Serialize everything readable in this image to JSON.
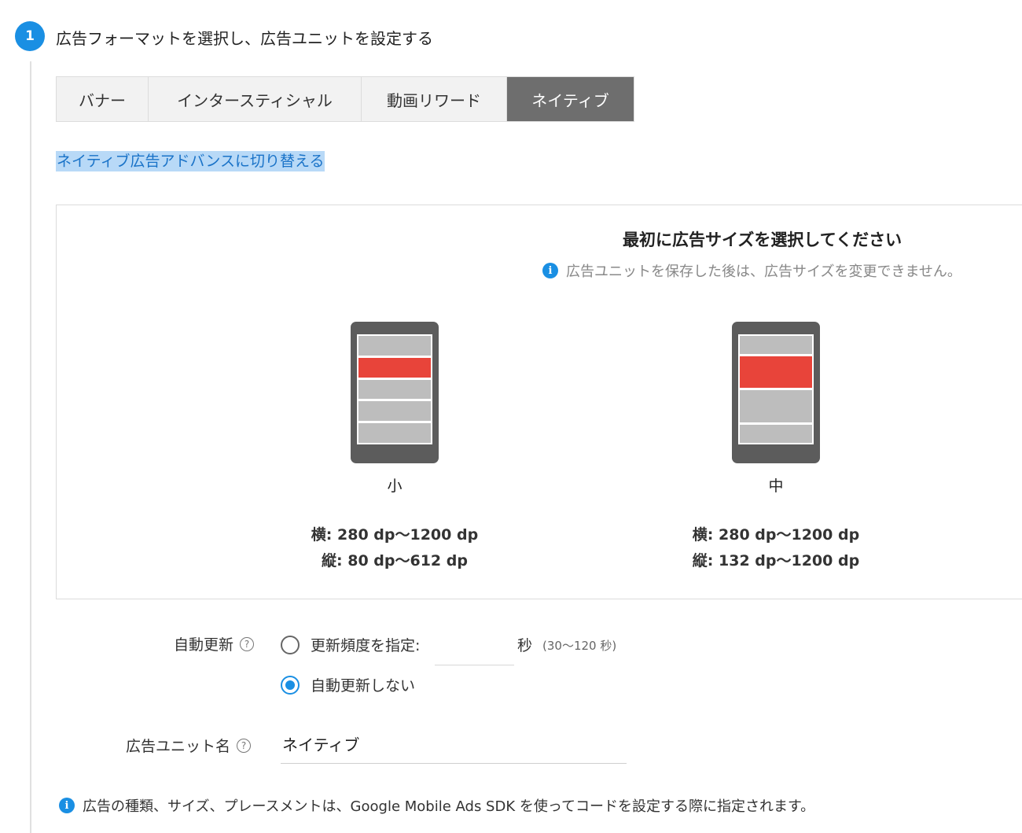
{
  "step": {
    "number": "1",
    "title": "広告フォーマットを選択し、広告ユニットを設定する"
  },
  "tabs": [
    {
      "label": "バナー",
      "active": false
    },
    {
      "label": "インタースティシャル",
      "active": false
    },
    {
      "label": "動画リワード",
      "active": false
    },
    {
      "label": "ネイティブ",
      "active": true
    }
  ],
  "switch_link": "ネイティブ広告アドバンスに切り替える",
  "size_panel": {
    "title": "最初に広告サイズを選択してください",
    "info_icon": "i",
    "info_text": "広告ユニットを保存した後は、広告サイズを変更できません。",
    "options": [
      {
        "label": "小",
        "width_text": "横: 280 dp〜1200 dp",
        "height_text": "縦: 80 dp〜612 dp"
      },
      {
        "label": "中",
        "width_text": "横: 280 dp〜1200 dp",
        "height_text": "縦: 132 dp〜1200 dp"
      }
    ]
  },
  "auto_refresh": {
    "label": "自動更新",
    "help_icon": "?",
    "option_interval_label": "更新頻度を指定:",
    "interval_value": "",
    "unit": "秒",
    "range": "(30〜120 秒)",
    "option_off_label": "自動更新しない",
    "selected": "off"
  },
  "ad_unit_name": {
    "label": "広告ユニット名",
    "help_icon": "?",
    "value": "ネイティブ"
  },
  "bottom_note": {
    "icon": "i",
    "text": "広告の種類、サイズ、プレースメントは、Google Mobile Ads SDK を使ってコードを設定する際に指定されます。"
  },
  "colors": {
    "accent": "#1a8fe3",
    "ad_highlight": "#e8443a",
    "active_tab": "#6e6e6e",
    "link": "#1a73c8",
    "link_highlight": "#b8d9f7"
  }
}
